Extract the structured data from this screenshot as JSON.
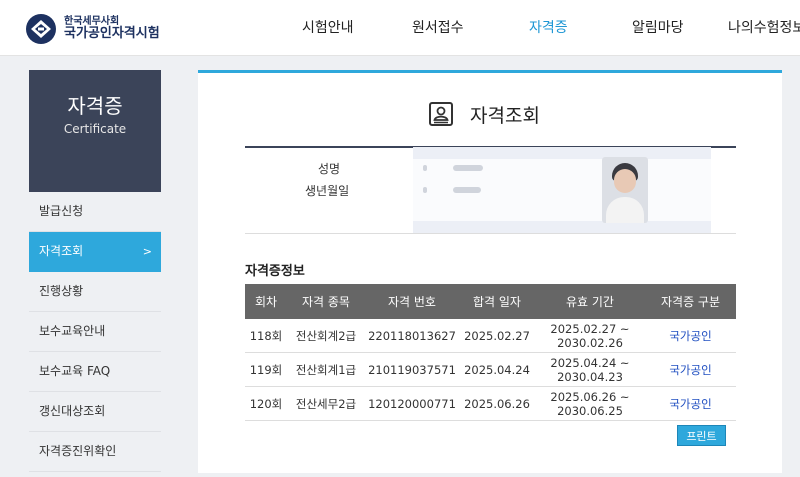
{
  "header": {
    "org_name": "한국세무사회",
    "site_name": "국가공인자격시험",
    "nav": [
      {
        "label": "시험안내"
      },
      {
        "label": "원서접수"
      },
      {
        "label": "자격증"
      },
      {
        "label": "알림마당"
      },
      {
        "label": "나의수험정보"
      }
    ],
    "active_nav": "자격증",
    "colors": {
      "accent": "#2ea8dc",
      "brand": "#1d3160",
      "sidebar_head": "#3b4459"
    }
  },
  "sidebar": {
    "title": "자격증",
    "subtitle": "Certificate",
    "items": [
      {
        "label": "발급신청"
      },
      {
        "label": "자격조회",
        "active": true,
        "arrow": ">"
      },
      {
        "label": "진행상황"
      },
      {
        "label": "보수교육안내"
      },
      {
        "label": "보수교육 FAQ"
      },
      {
        "label": "갱신대상조회"
      },
      {
        "label": "자격증진위확인"
      }
    ]
  },
  "main": {
    "title": "자격조회",
    "title_icon": "id-card-icon",
    "info": {
      "name_label": "성명",
      "birth_label": "생년월일"
    },
    "cert_section": {
      "title": "자격증정보",
      "columns": [
        "회차",
        "자격 종목",
        "자격 번호",
        "합격 일자",
        "유효 기간",
        "자격증 구분"
      ],
      "rows": [
        {
          "round": "118회",
          "item": "전산회계2급",
          "number": "220118013627",
          "pass_date": "2025.02.27",
          "valid_from": "2025.02.27 ~",
          "valid_to": "2030.02.26",
          "type": "국가공인"
        },
        {
          "round": "119회",
          "item": "전산회계1급",
          "number": "210119037571",
          "pass_date": "2025.04.24",
          "valid_from": "2025.04.24 ~",
          "valid_to": "2030.04.23",
          "type": "국가공인"
        },
        {
          "round": "120회",
          "item": "전산세무2급",
          "number": "120120000771",
          "pass_date": "2025.06.26",
          "valid_from": "2025.06.26 ~",
          "valid_to": "2030.06.25",
          "type": "국가공인"
        }
      ]
    },
    "print_label": "프린트"
  }
}
